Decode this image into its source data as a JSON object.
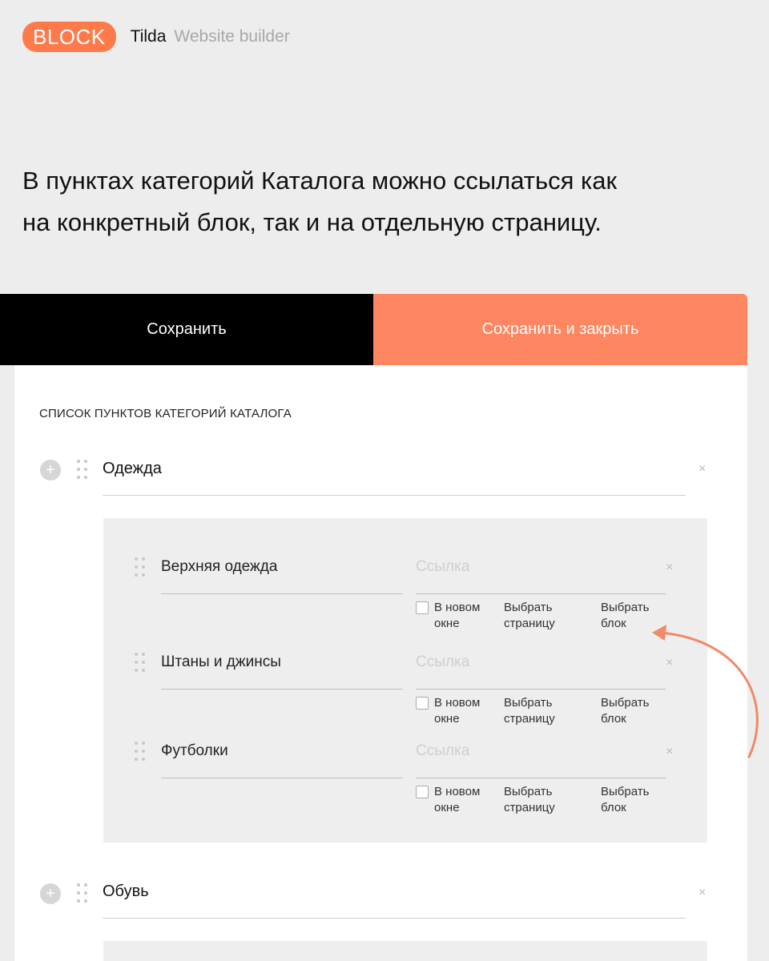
{
  "header": {
    "badge": "BLOCK",
    "brand": "Tilda",
    "subtitle": "Website builder"
  },
  "intro": {
    "line1": "В пунктах категорий Каталога можно ссылаться как",
    "line2": "на конкретный блок, так и на отдельную страницу."
  },
  "toolbar": {
    "save_label": "Сохранить",
    "save_close_label": "Сохранить и закрыть"
  },
  "list": {
    "title": "СПИСОК ПУНКТОВ КАТЕГОРИЙ КАТАЛОГА",
    "categories": [
      {
        "title": "Одежда",
        "items": [
          {
            "title": "Верхняя одежда",
            "link_placeholder": "Ссылка"
          },
          {
            "title": "Штаны и джинсы",
            "link_placeholder": "Ссылка"
          },
          {
            "title": "Футболки",
            "link_placeholder": "Ссылка"
          }
        ]
      },
      {
        "title": "Обувь"
      }
    ],
    "options": {
      "new_window_1": "В новом",
      "new_window_2": "окне",
      "choose_page_1": "Выбрать",
      "choose_page_2": "страницу",
      "choose_block_1": "Выбрать",
      "choose_block_2": "блок"
    },
    "close_glyph": "×",
    "add_glyph": "+"
  },
  "colors": {
    "accent": "#ff7a4a",
    "save_close_bg": "#fe8660",
    "save_bg": "#000000",
    "page_bg": "#ededed",
    "sub_box_bg": "#eeeeee",
    "arrow": "#f08a6a"
  },
  "icons": {
    "add": "plus-circle-icon",
    "drag": "drag-handle-icon",
    "close": "close-icon",
    "checkbox": "checkbox-icon"
  }
}
